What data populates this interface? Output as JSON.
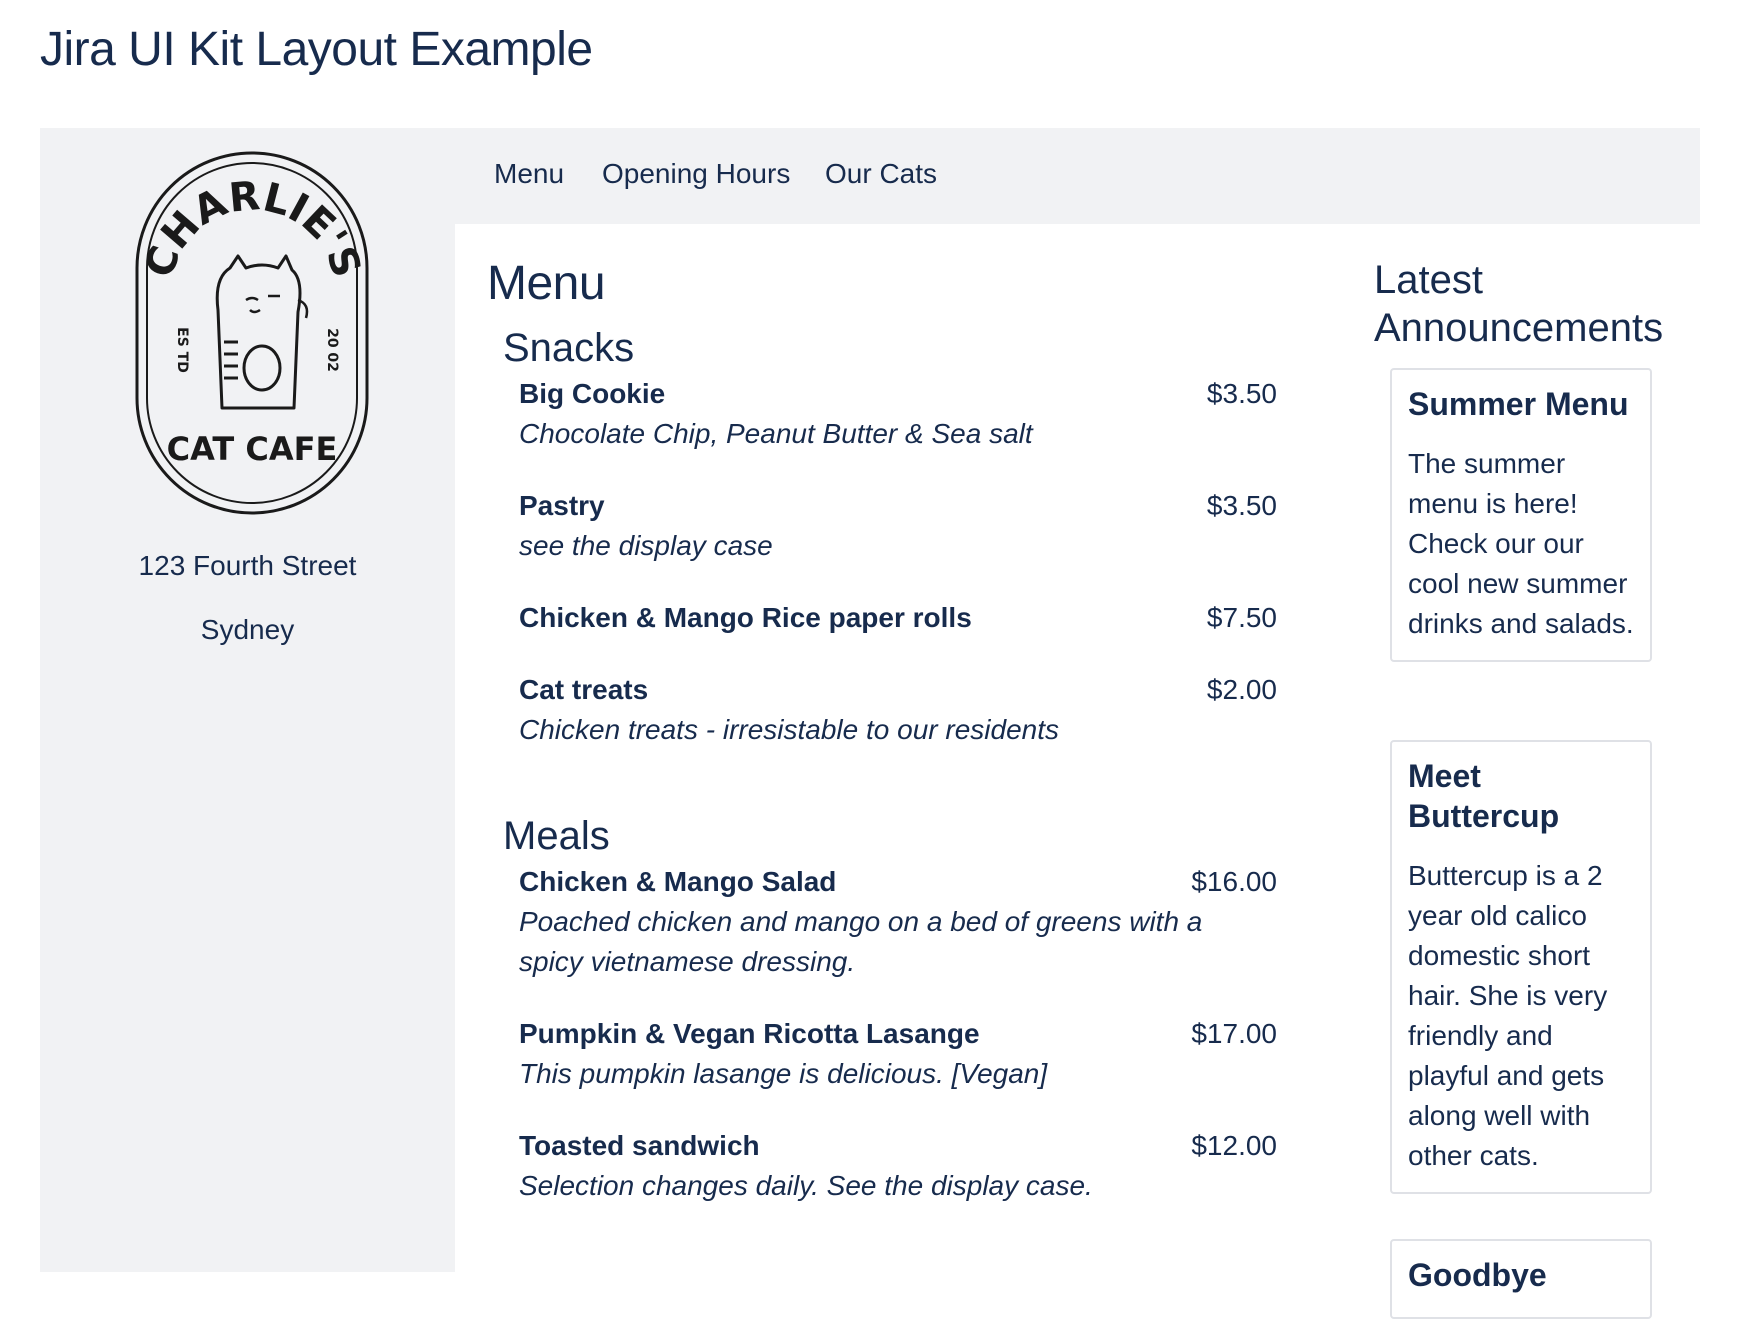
{
  "page": {
    "title": "Jira UI Kit Layout Example"
  },
  "sidebar": {
    "logo": {
      "top_text": "CHARLIE'S",
      "left_text": "ES TD",
      "right_text": "20 02",
      "bottom_text": "CAT CAFE"
    },
    "address_line1": "123 Fourth Street",
    "address_line2": "Sydney"
  },
  "nav": {
    "items": [
      {
        "label": "Menu"
      },
      {
        "label": "Opening Hours"
      },
      {
        "label": "Our Cats"
      }
    ]
  },
  "menu": {
    "heading": "Menu",
    "sections": [
      {
        "title": "Snacks",
        "items": [
          {
            "name": "Big Cookie",
            "price": "$3.50",
            "description": "Chocolate Chip, Peanut Butter & Sea salt"
          },
          {
            "name": "Pastry",
            "price": "$3.50",
            "description": "see the display case"
          },
          {
            "name": "Chicken & Mango Rice paper rolls",
            "price": "$7.50",
            "description": ""
          },
          {
            "name": "Cat treats",
            "price": "$2.00",
            "description": "Chicken treats - irresistable to our residents"
          }
        ]
      },
      {
        "title": "Meals",
        "items": [
          {
            "name": "Chicken & Mango Salad",
            "price": "$16.00",
            "description": "Poached chicken and mango on a bed of greens with a spicy vietnamese dressing."
          },
          {
            "name": "Pumpkin & Vegan Ricotta Lasange",
            "price": "$17.00",
            "description": "This pumpkin lasange is delicious. [Vegan]"
          },
          {
            "name": "Toasted sandwich",
            "price": "$12.00",
            "description": "Selection changes daily. See the display case."
          }
        ]
      }
    ]
  },
  "announcements": {
    "heading": "Latest Announcements",
    "cards": [
      {
        "title": "Summer Menu",
        "body": "The summer menu is here! Check our our cool new summer drinks and salads."
      },
      {
        "title": "Meet Buttercup",
        "body": "Buttercup is a 2 year old calico domestic short hair. She is very friendly and playful and gets along well with other cats."
      },
      {
        "title": "Goodbye",
        "body": ""
      }
    ]
  }
}
